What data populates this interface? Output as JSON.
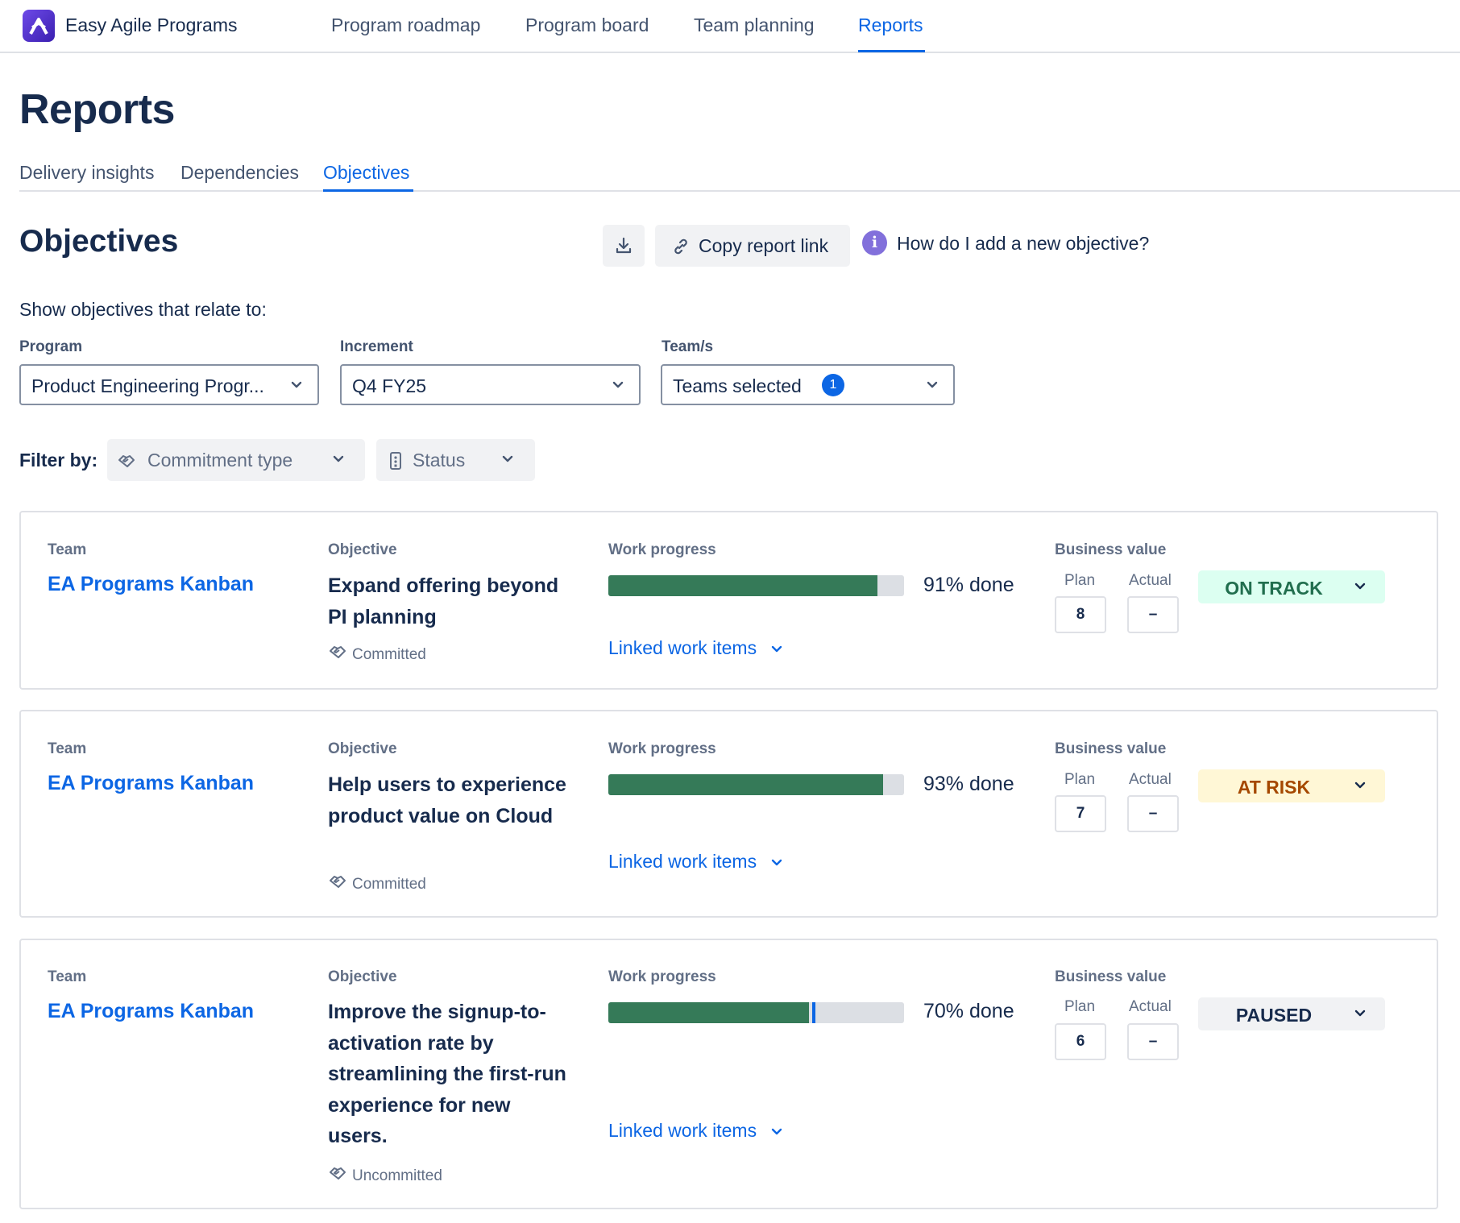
{
  "app": {
    "name": "Easy Agile Programs",
    "nav": [
      "Program roadmap",
      "Program board",
      "Team planning",
      "Reports"
    ],
    "active_nav": "Reports"
  },
  "page": {
    "title": "Reports",
    "tabs": [
      "Delivery insights",
      "Dependencies",
      "Objectives"
    ],
    "active_tab": "Objectives"
  },
  "objectives_section": {
    "title": "Objectives",
    "download_icon": "download-icon",
    "copy_link_label": "Copy report link",
    "info_glyph": "i",
    "help_text": "How do I add a new objective?",
    "relate_label": "Show objectives that relate to:",
    "filters": {
      "program": {
        "label": "Program",
        "value": "Product Engineering Progr..."
      },
      "increment": {
        "label": "Increment",
        "value": "Q4 FY25"
      },
      "teams": {
        "label": "Team/s",
        "value": "Teams selected",
        "count": "1"
      }
    },
    "filter_by": {
      "label": "Filter by:",
      "commitment_type": "Commitment type",
      "status": "Status"
    }
  },
  "headers": {
    "team": "Team",
    "objective": "Objective",
    "work_progress": "Work progress",
    "business_value": "Business value",
    "plan": "Plan",
    "actual": "Actual",
    "linked": "Linked work items"
  },
  "objectives": [
    {
      "team": "EA Programs Kanban",
      "title": "Expand offering beyond PI planning",
      "commitment": "Committed",
      "progress": 0.91,
      "progress_label": "91% done",
      "plan": "8",
      "actual": "–",
      "status": "ON TRACK",
      "status_bg": "#dcfff1",
      "status_fg": "#216e4e"
    },
    {
      "team": "EA Programs Kanban",
      "title": "Help users to experience product value on Cloud",
      "commitment": "Committed",
      "progress": 0.93,
      "progress_label": "93% done",
      "plan": "7",
      "actual": "–",
      "status": "AT RISK",
      "status_bg": "#fff7d6",
      "status_fg": "#a54800"
    },
    {
      "team": "EA Programs Kanban",
      "title": "Improve the signup-to-activation rate by streamlining the first-run experience for new users.",
      "commitment": "Uncommitted",
      "progress": 0.7,
      "progress_label": "70% done",
      "plan": "6",
      "actual": "–",
      "status": "PAUSED",
      "status_bg": "#f1f2f4",
      "status_fg": "#172b4d"
    }
  ]
}
